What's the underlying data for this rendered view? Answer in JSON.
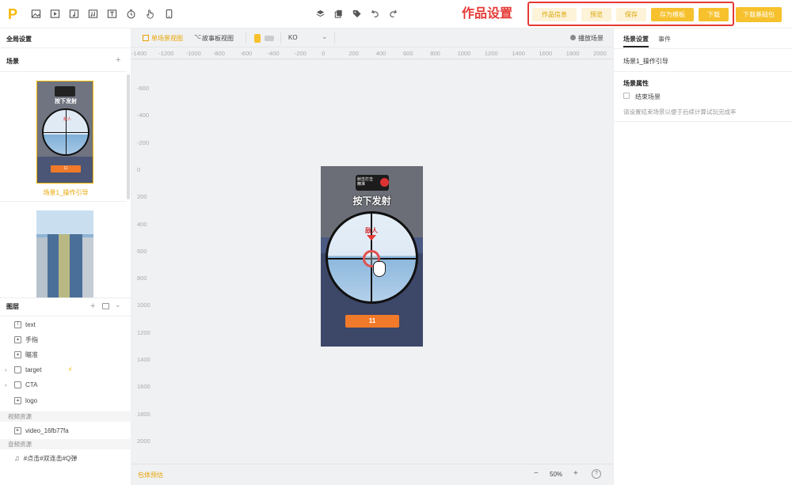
{
  "topbar": {
    "logo": "P",
    "tools": [
      "image-icon",
      "video-icon",
      "music-note-icon",
      "audio-icon",
      "text-icon",
      "timer-icon",
      "hand-pointer-icon",
      "phone-icon"
    ],
    "center_tools": [
      "layers-icon",
      "copy-icon",
      "tag-icon",
      "undo-icon",
      "redo-icon"
    ],
    "section_title": "作品设置",
    "buttons": {
      "info": "作品信息",
      "preview": "预览",
      "save": "保存",
      "save_template": "存为模板",
      "download": "下载",
      "download_base": "下载基础包"
    }
  },
  "left": {
    "global_settings": "全局设置",
    "scenes_label": "场景",
    "scene1_label": "场景1_操作引导",
    "layers_label": "图层",
    "layers": [
      {
        "name": "text",
        "icon": "text-icon"
      },
      {
        "name": "手指",
        "icon": "image-icon"
      },
      {
        "name": "瞄准",
        "icon": "image-icon"
      },
      {
        "name": "target",
        "icon": "folder-icon"
      },
      {
        "name": "CTA",
        "icon": "folder-icon"
      },
      {
        "name": "logo",
        "icon": "image-icon"
      }
    ],
    "video_res_label": "视频资源",
    "video_file": "video_16fb77fa",
    "audio_res_label": "音频资源",
    "audio_file": "#点击#双连击#Q弹"
  },
  "canvas": {
    "single_view": "单场景视图",
    "story_view": "故事板视图",
    "lang": "KO",
    "play_scene": "播放场景",
    "ruler_top": [
      "-1400",
      "-1200",
      "-1000",
      "-800",
      "-600",
      "-400",
      "-200",
      "0",
      "200",
      "400",
      "600",
      "800",
      "1000",
      "1200",
      "1400",
      "1600",
      "1800",
      "2000"
    ],
    "ruler_left": [
      "-600",
      "-400",
      "-200",
      "0",
      "200",
      "400",
      "600",
      "800",
      "1000",
      "1200",
      "1400",
      "1600",
      "1800",
      "2000"
    ],
    "phone": {
      "badge": "射击打击\n精准",
      "title": "按下发射",
      "enemy": "敌人",
      "cta": "11"
    },
    "thumb": {
      "title": "按下发射",
      "enemy": "敌人",
      "cta": "11"
    },
    "bottom_left": "包体预估",
    "zoom": "50%",
    "zoom_minus": "−",
    "zoom_plus": "+",
    "help": "?"
  },
  "right": {
    "tab_scene": "场景设置",
    "tab_event": "事件",
    "scene_name": "场景1_操作引导",
    "props_title": "场景属性",
    "end_scene": "结束场景",
    "hint": "请设置结束场景以便于后续计算试玩完成率"
  },
  "colors": {
    "accent": "#f6c12c",
    "accent_light": "#fdf3d9",
    "highlight": "#e53935",
    "cta": "#f07a2a"
  }
}
